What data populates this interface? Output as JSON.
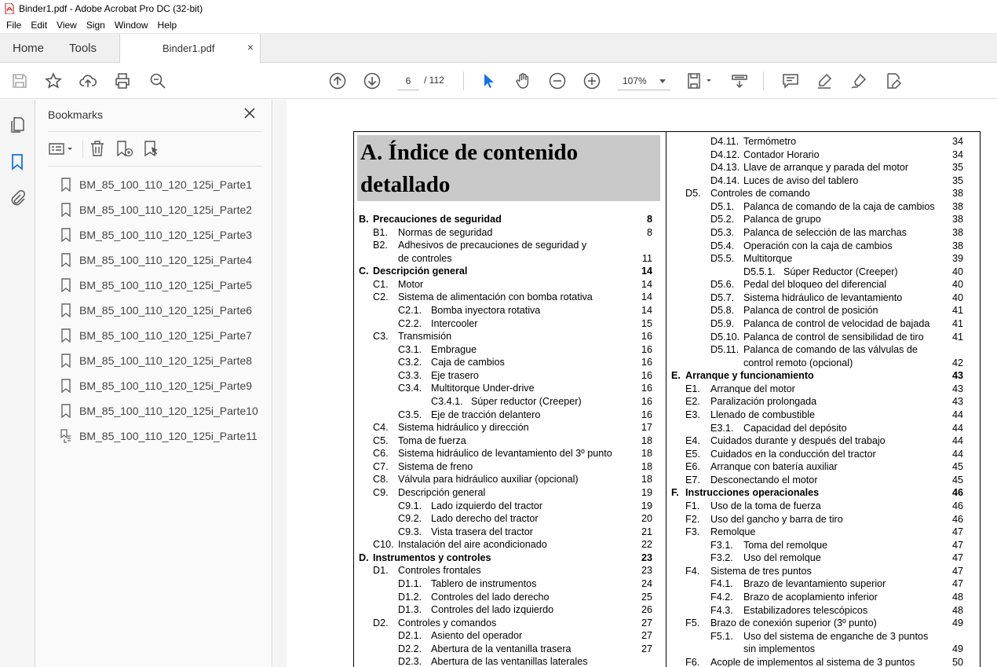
{
  "window": {
    "title": "Binder1.pdf - Adobe Acrobat Pro DC (32-bit)"
  },
  "menu": [
    "File",
    "Edit",
    "View",
    "Sign",
    "Window",
    "Help"
  ],
  "tabs": {
    "home": "Home",
    "tools": "Tools",
    "document": "Binder1.pdf",
    "close": "×"
  },
  "toolbar": {
    "page_current": "6",
    "page_total": "/ 112",
    "zoom": "107%"
  },
  "bookmarks": {
    "title": "Bookmarks",
    "items": [
      "BM_85_100_110_120_125i_Parte1",
      "BM_85_100_110_120_125i_Parte2",
      "BM_85_100_110_120_125i_Parte3",
      "BM_85_100_110_120_125i_Parte4",
      "BM_85_100_110_120_125i_Parte5",
      "BM_85_100_110_120_125i_Parte6",
      "BM_85_100_110_120_125i_Parte7",
      "BM_85_100_110_120_125i_Parte8",
      "BM_85_100_110_120_125i_Parte9",
      "BM_85_100_110_120_125i_Parte10",
      "BM_85_100_110_120_125i_Parte11"
    ]
  },
  "document": {
    "heading_line1": "A.  Índice de contenido",
    "heading_line2": "detallado",
    "left": [
      {
        "n": "B.",
        "t": "Precauciones de seguridad",
        "p": "8",
        "lvl": 0,
        "b": true
      },
      {
        "n": "B1.",
        "t": "Normas de seguridad",
        "p": "8",
        "lvl": 1
      },
      {
        "n": "B2.",
        "t": "Adhesivos de precauciones de seguridad y",
        "p": "",
        "lvl": 1
      },
      {
        "n": "",
        "t": "de controles",
        "p": "11",
        "lvl": 1
      },
      {
        "n": "C.",
        "t": "Descripción general",
        "p": "14",
        "lvl": 0,
        "b": true
      },
      {
        "n": "C1.",
        "t": "Motor",
        "p": "14",
        "lvl": 1
      },
      {
        "n": "C2.",
        "t": "Sistema de alimentación con bomba rotativa",
        "p": "14",
        "lvl": 1
      },
      {
        "n": "C2.1.",
        "t": "Bomba inyectora rotativa",
        "p": "14",
        "lvl": 2
      },
      {
        "n": "C2.2.",
        "t": "Intercooler",
        "p": "15",
        "lvl": 2
      },
      {
        "n": "C3.",
        "t": "Transmisión",
        "p": "16",
        "lvl": 1
      },
      {
        "n": "C3.1.",
        "t": "Embrague",
        "p": "16",
        "lvl": 2
      },
      {
        "n": "C3.2.",
        "t": "Caja de cambios",
        "p": "16",
        "lvl": 2
      },
      {
        "n": "C3.3.",
        "t": "Eje trasero",
        "p": "16",
        "lvl": 2
      },
      {
        "n": "C3.4.",
        "t": "Multitorque Under-drive",
        "p": "16",
        "lvl": 2
      },
      {
        "n": "C3.4.1.",
        "t": "Súper reductor (Creeper)",
        "p": "16",
        "lvl": 3
      },
      {
        "n": "C3.5.",
        "t": "Eje de tracción delantero",
        "p": "16",
        "lvl": 2
      },
      {
        "n": "C4.",
        "t": "Sistema hidráulico y dirección",
        "p": "17",
        "lvl": 1
      },
      {
        "n": "C5.",
        "t": "Toma de fuerza",
        "p": "18",
        "lvl": 1
      },
      {
        "n": "C6.",
        "t": "Sistema hidráulico de levantamiento del 3º punto",
        "p": "18",
        "lvl": 1
      },
      {
        "n": "C7.",
        "t": "Sistema de freno",
        "p": "18",
        "lvl": 1
      },
      {
        "n": "C8.",
        "t": "Válvula para hidráulico auxiliar (opcional)",
        "p": "18",
        "lvl": 1
      },
      {
        "n": "C9.",
        "t": "Descripción general",
        "p": "19",
        "lvl": 1
      },
      {
        "n": "C9.1.",
        "t": "Lado izquierdo del tractor",
        "p": "19",
        "lvl": 2
      },
      {
        "n": "C9.2.",
        "t": "Lado derecho del tractor",
        "p": "20",
        "lvl": 2
      },
      {
        "n": "C9.3.",
        "t": "Vista trasera del tractor",
        "p": "21",
        "lvl": 2
      },
      {
        "n": "C10.",
        "t": "Instalación del aire acondicionado",
        "p": "22",
        "lvl": 1
      },
      {
        "n": "D.",
        "t": "Instrumentos y controles",
        "p": "23",
        "lvl": 0,
        "b": true
      },
      {
        "n": "D1.",
        "t": "Controles frontales",
        "p": "23",
        "lvl": 1
      },
      {
        "n": "D1.1.",
        "t": "Tablero de instrumentos",
        "p": "24",
        "lvl": 2
      },
      {
        "n": "D1.2.",
        "t": "Controles del lado derecho",
        "p": "25",
        "lvl": 2
      },
      {
        "n": "D1.3.",
        "t": "Controles del lado izquierdo",
        "p": "26",
        "lvl": 2
      },
      {
        "n": "D2.",
        "t": "Controles y comandos",
        "p": "27",
        "lvl": 1
      },
      {
        "n": "D2.1.",
        "t": "Asiento del operador",
        "p": "27",
        "lvl": 2
      },
      {
        "n": "D2.2.",
        "t": "Abertura de la ventanilla trasera",
        "p": "27",
        "lvl": 2
      },
      {
        "n": "D2.3.",
        "t": "Abertura de las ventanillas laterales",
        "p": "",
        "lvl": 2
      }
    ],
    "right": [
      {
        "n": "D4.11.",
        "t": "Termómetro",
        "p": "34",
        "lvl": 2
      },
      {
        "n": "D4.12.",
        "t": "Contador Horario",
        "p": "34",
        "lvl": 2
      },
      {
        "n": "D4.13.",
        "t": "Llave de arranque y parada del motor",
        "p": "35",
        "lvl": 2
      },
      {
        "n": "D4.14.",
        "t": "Luces de aviso del tablero",
        "p": "35",
        "lvl": 2
      },
      {
        "n": "D5.",
        "t": "Controles de comando",
        "p": "38",
        "lvl": 1
      },
      {
        "n": "D5.1.",
        "t": "Palanca de comando de la caja de cambios",
        "p": "38",
        "lvl": 2
      },
      {
        "n": "D5.2.",
        "t": "Palanca de grupo",
        "p": "38",
        "lvl": 2
      },
      {
        "n": "D5.3.",
        "t": "Palanca de selección de las marchas",
        "p": "38",
        "lvl": 2
      },
      {
        "n": "D5.4.",
        "t": "Operación con la caja de cambios",
        "p": "38",
        "lvl": 2
      },
      {
        "n": "D5.5.",
        "t": "Multitorque",
        "p": "39",
        "lvl": 2
      },
      {
        "n": "D5.5.1.",
        "t": "Súper Reductor (Creeper)",
        "p": "40",
        "lvl": 3
      },
      {
        "n": "D5.6.",
        "t": "Pedal del bloqueo del diferencial",
        "p": "40",
        "lvl": 2
      },
      {
        "n": "D5.7.",
        "t": "Sistema hidráulico de levantamiento",
        "p": "40",
        "lvl": 2
      },
      {
        "n": "D5.8.",
        "t": "Palanca de control de posición",
        "p": "41",
        "lvl": 2
      },
      {
        "n": "D5.9.",
        "t": "Palanca de control de velocidad de bajada",
        "p": "41",
        "lvl": 2
      },
      {
        "n": "D5.10.",
        "t": "Palanca de control de sensibilidad de tiro",
        "p": "41",
        "lvl": 2
      },
      {
        "n": "D5.11.",
        "t": "Palanca de comando de las válvulas de",
        "p": "",
        "lvl": 2
      },
      {
        "n": "",
        "t": "control remoto (opcional)",
        "p": "42",
        "lvl": 2
      },
      {
        "n": "E.",
        "t": "Arranque y funcionamiento",
        "p": "43",
        "lvl": 0,
        "b": true
      },
      {
        "n": "E1.",
        "t": "Arranque del motor",
        "p": "43",
        "lvl": 1
      },
      {
        "n": "E2.",
        "t": "Paralización prolongada",
        "p": "43",
        "lvl": 1
      },
      {
        "n": "E3.",
        "t": "Llenado de combustible",
        "p": "44",
        "lvl": 1
      },
      {
        "n": "E3.1.",
        "t": "Capacidad del depósito",
        "p": "44",
        "lvl": 2
      },
      {
        "n": "E4.",
        "t": "Cuidados durante y después del trabajo",
        "p": "44",
        "lvl": 1
      },
      {
        "n": "E5.",
        "t": "Cuidados en la conducción del tractor",
        "p": "44",
        "lvl": 1
      },
      {
        "n": "E6.",
        "t": "Arranque con batería auxiliar",
        "p": "45",
        "lvl": 1
      },
      {
        "n": "E7.",
        "t": "Desconectando el motor",
        "p": "45",
        "lvl": 1
      },
      {
        "n": "F.",
        "t": "Instrucciones operacionales",
        "p": "46",
        "lvl": 0,
        "b": true
      },
      {
        "n": "F1.",
        "t": "Uso de la toma de fuerza",
        "p": "46",
        "lvl": 1
      },
      {
        "n": "F2.",
        "t": "Uso del gancho y barra de tiro",
        "p": "46",
        "lvl": 1
      },
      {
        "n": "F3.",
        "t": "Remolque",
        "p": "47",
        "lvl": 1
      },
      {
        "n": "F3.1.",
        "t": "Toma del remolque",
        "p": "47",
        "lvl": 2
      },
      {
        "n": "F3.2.",
        "t": "Uso del remolque",
        "p": "47",
        "lvl": 2
      },
      {
        "n": "F4.",
        "t": "Sistema de tres puntos",
        "p": "47",
        "lvl": 1
      },
      {
        "n": "F4.1.",
        "t": "Brazo de levantamiento superior",
        "p": "47",
        "lvl": 2
      },
      {
        "n": "F4.2.",
        "t": "Brazo de acoplamiento inferior",
        "p": "48",
        "lvl": 2
      },
      {
        "n": "F4.3.",
        "t": "Estabilizadores telescópicos",
        "p": "48",
        "lvl": 2
      },
      {
        "n": "F5.",
        "t": "Brazo de conexión superior (3º punto)",
        "p": "49",
        "lvl": 1
      },
      {
        "n": "F5.1.",
        "t": "Uso del sistema de enganche de 3 puntos",
        "p": "",
        "lvl": 2
      },
      {
        "n": "",
        "t": "sin implementos",
        "p": "49",
        "lvl": 2
      },
      {
        "n": "F6.",
        "t": "Acople de implementos al sistema de 3 puntos",
        "p": "50",
        "lvl": 1
      }
    ]
  }
}
